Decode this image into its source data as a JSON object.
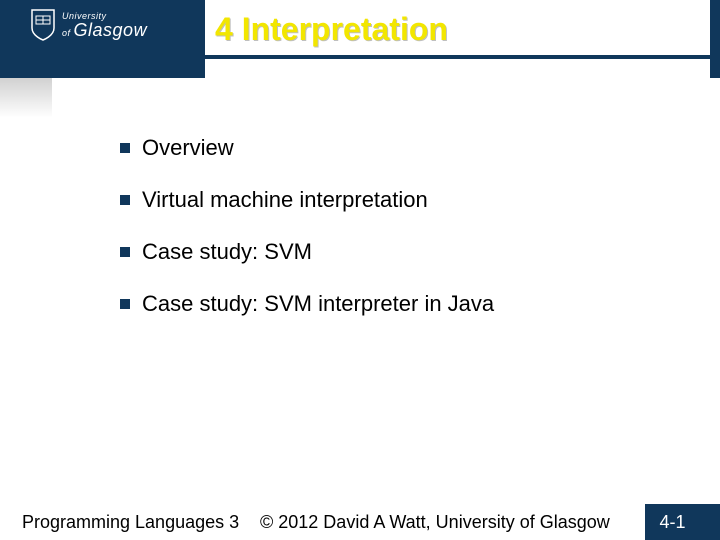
{
  "logo": {
    "line1": "University",
    "of": "of",
    "line2": "Glasgow"
  },
  "title": "4  Interpretation",
  "bullets": [
    "Overview",
    "Virtual machine interpretation",
    "Case study: SVM",
    "Case study: SVM interpreter in Java"
  ],
  "footer": {
    "course": "Programming Languages 3",
    "copyright": "© 2012 David A Watt, University of Glasgow",
    "page": "4-1"
  }
}
